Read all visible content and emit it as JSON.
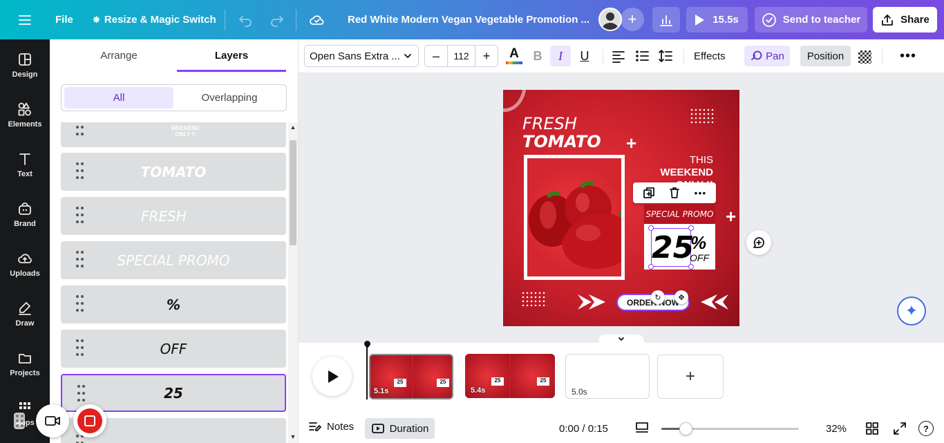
{
  "topbar": {
    "file_label": "File",
    "resize_label": "Resize & Magic Switch",
    "doc_title": "Red White Modern Vegan Vegetable Promotion ...",
    "play_time": "15.5s",
    "send_label": "Send to teacher",
    "share_label": "Share"
  },
  "rail": {
    "items": [
      {
        "label": "Design",
        "icon": "design-icon"
      },
      {
        "label": "Elements",
        "icon": "elements-icon"
      },
      {
        "label": "Text",
        "icon": "text-icon"
      },
      {
        "label": "Brand",
        "icon": "brand-icon"
      },
      {
        "label": "Uploads",
        "icon": "uploads-icon"
      },
      {
        "label": "Draw",
        "icon": "draw-icon"
      },
      {
        "label": "Projects",
        "icon": "projects-icon"
      },
      {
        "label": "Apps",
        "icon": "apps-icon"
      }
    ]
  },
  "panel": {
    "tab_arrange": "Arrange",
    "tab_layers": "Layers",
    "seg_all": "All",
    "seg_overlapping": "Overlapping",
    "layers": [
      {
        "text": "WEEKEND ONLY !!"
      },
      {
        "text": "TOMATO"
      },
      {
        "text": "FRESH"
      },
      {
        "text": "SPECIAL PROMO"
      },
      {
        "text": "%"
      },
      {
        "text": "OFF"
      },
      {
        "text": "25"
      }
    ]
  },
  "toolbar": {
    "font_name": "Open Sans Extra ...",
    "font_size": "112",
    "bold": "B",
    "italic": "I",
    "underline": "U",
    "effects_label": "Effects",
    "pan_label": "Pan",
    "position_label": "Position"
  },
  "design": {
    "fresh": "FRESH",
    "tomato": "TOMATO",
    "this": "THIS",
    "weekend": "WEEKEND",
    "only": "ONLY !!",
    "special_promo": "SPECIAL PROMO",
    "number": "25",
    "percent": "%",
    "off": "OFF",
    "order_now": "ORDER NOW"
  },
  "timeline": {
    "pages": [
      {
        "duration": "5.1s"
      },
      {
        "duration": "5.4s"
      },
      {
        "duration": "5.0s"
      }
    ]
  },
  "footer": {
    "notes_label": "Notes",
    "duration_label": "Duration",
    "time": "0:00 / 0:15",
    "zoom": "32%",
    "zoom_fraction": 0.32
  },
  "colors": {
    "accent": "#8b3dff",
    "design_red": "#c41e2a"
  }
}
